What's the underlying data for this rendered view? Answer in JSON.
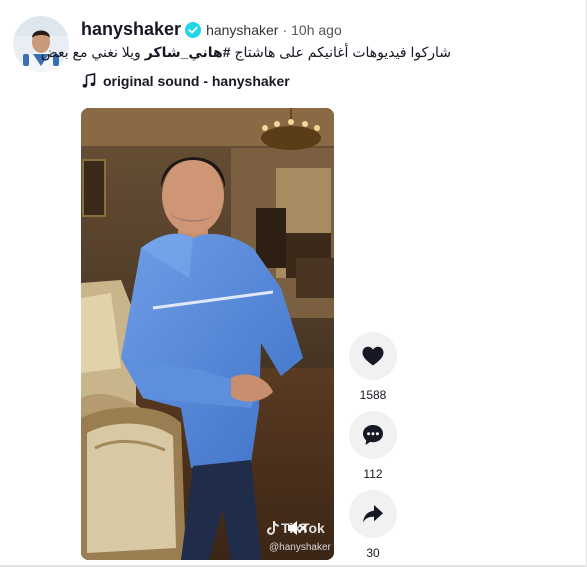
{
  "post": {
    "author": {
      "username": "hanyshaker",
      "nickname": "hanyshaker",
      "separator": "·",
      "time": "10h ago",
      "verified": true
    },
    "caption": {
      "before": "شاركوا فيديوهات أغانيكم على هاشتاج ",
      "hashtag": "#هاني_شاكر",
      "after": " ويلا نغني مع بعض"
    },
    "music": {
      "title": "original sound - hanyshaker"
    },
    "video": {
      "watermark_brand": "TikTok",
      "watermark_handle": "@hanyshaker"
    },
    "actions": {
      "likes": "1588",
      "comments": "112",
      "shares": "30"
    }
  },
  "colors": {
    "verified": "#20D5EC",
    "text_primary": "#161823",
    "action_bg": "#f1f1f2"
  },
  "icons": [
    "verified-badge-icon",
    "music-note-icon",
    "heart-icon",
    "comment-icon",
    "share-icon",
    "mute-icon",
    "tiktok-logo-icon"
  ]
}
